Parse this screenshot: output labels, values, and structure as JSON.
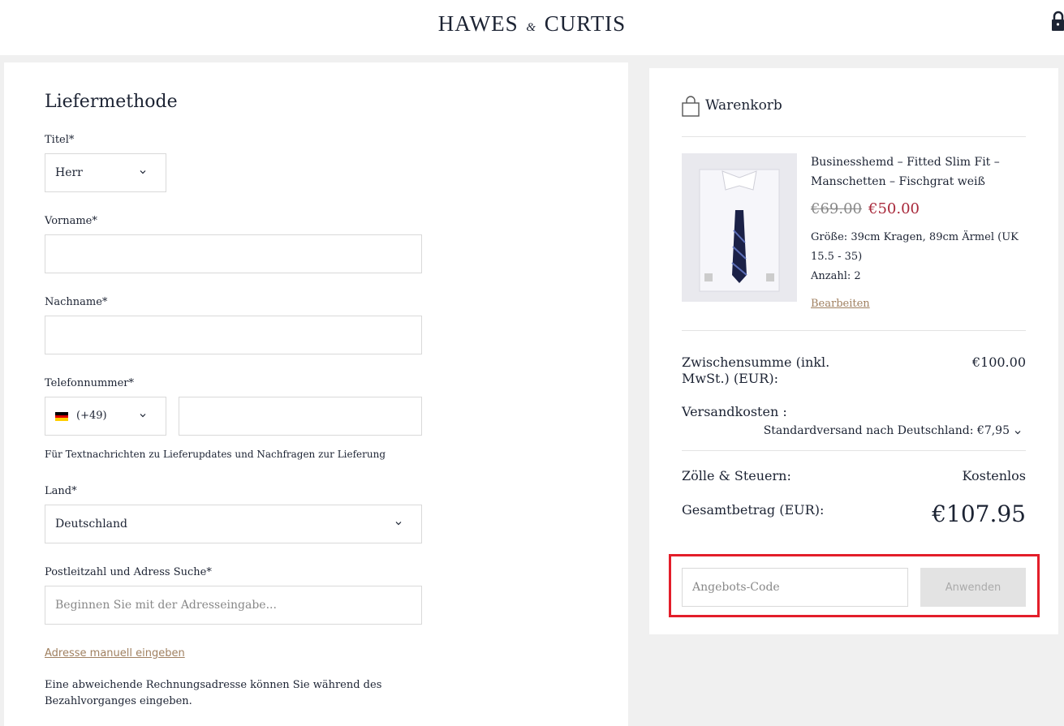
{
  "header": {
    "logo_left": "HAWES",
    "logo_amp": "&",
    "logo_right": "CURTIS"
  },
  "form": {
    "title": "Liefermethode",
    "salutation": {
      "label": "Titel*",
      "value": "Herr"
    },
    "first_name": {
      "label": "Vorname*",
      "value": ""
    },
    "last_name": {
      "label": "Nachname*",
      "value": ""
    },
    "phone": {
      "label": "Telefonnummer*",
      "country_code": "(+49)",
      "value": "",
      "help": "Für Textnachrichten zu Lieferupdates und Nachfragen zur Lieferung"
    },
    "country": {
      "label": "Land*",
      "value": "Deutschland"
    },
    "address": {
      "label": "Postleitzahl und Adress Suche*",
      "placeholder": "Beginnen Sie mit der Adresseingabe..."
    },
    "manual_link": "Adresse manuell eingeben",
    "billing_note": "Eine abweichende Rechnungsadresse können Sie während des Bezahlvorganges eingeben."
  },
  "cart": {
    "title": "Warenkorb",
    "item": {
      "name": "Businesshemd – Fitted Slim Fit – Manschetten – Fischgrat weiß",
      "old_price": "€69.00",
      "new_price": "€50.00",
      "size": "Größe: 39cm Kragen, 89cm Ärmel (UK 15.5 - 35)",
      "quantity": "Anzahl: 2",
      "edit": "Bearbeiten"
    },
    "subtotal_label": "Zwischensumme (inkl. MwSt.) (EUR):",
    "subtotal_value": "€100.00",
    "shipping_label": "Versandkosten :",
    "shipping_option": "Standardversand nach Deutschland: €7,95",
    "duties_label": "Zölle & Steuern:",
    "duties_value": "Kostenlos",
    "total_label": "Gesamtbetrag (EUR):",
    "total_value": "€107.95",
    "promo_placeholder": "Angebots-Code",
    "apply_label": "Anwenden"
  },
  "colors": {
    "accent_red": "#a8283a",
    "highlight_box": "#e31e2a",
    "link": "#a08060"
  }
}
